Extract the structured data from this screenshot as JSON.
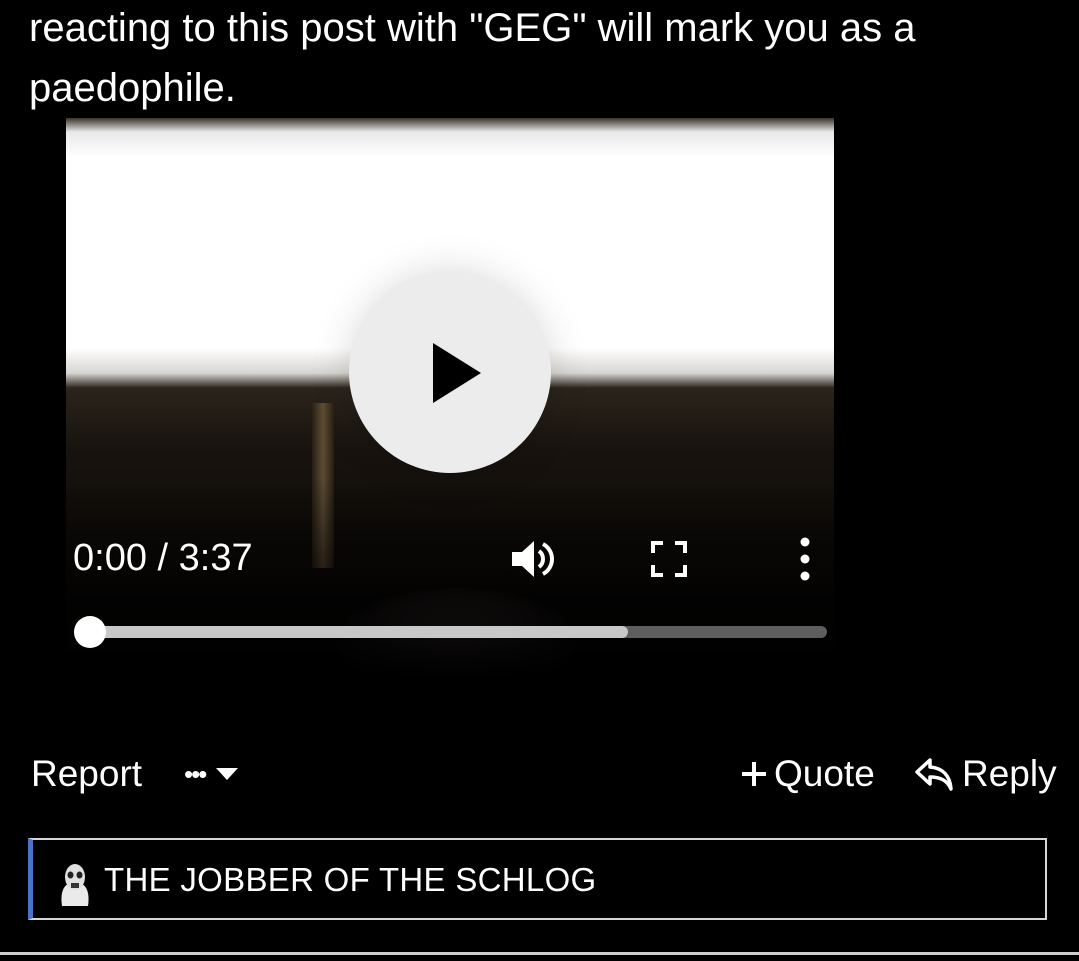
{
  "post": {
    "text": "reacting to this post with \"GEG\" will mark you as a paedophile."
  },
  "video": {
    "time_display": "0:00 / 3:37",
    "progress_fraction": 0,
    "buffered_fraction": 0.73,
    "icons": {
      "play": "play-icon",
      "volume": "volume-icon",
      "fullscreen": "fullscreen-icon",
      "more": "more-vertical-icon"
    }
  },
  "actions": {
    "report_label": "Report",
    "more_label": "•••",
    "quote_label": "Quote",
    "reply_label": "Reply"
  },
  "signature": {
    "name": "THE JOBBER OF THE SCHLOG",
    "accent_color": "#4a73c7"
  }
}
